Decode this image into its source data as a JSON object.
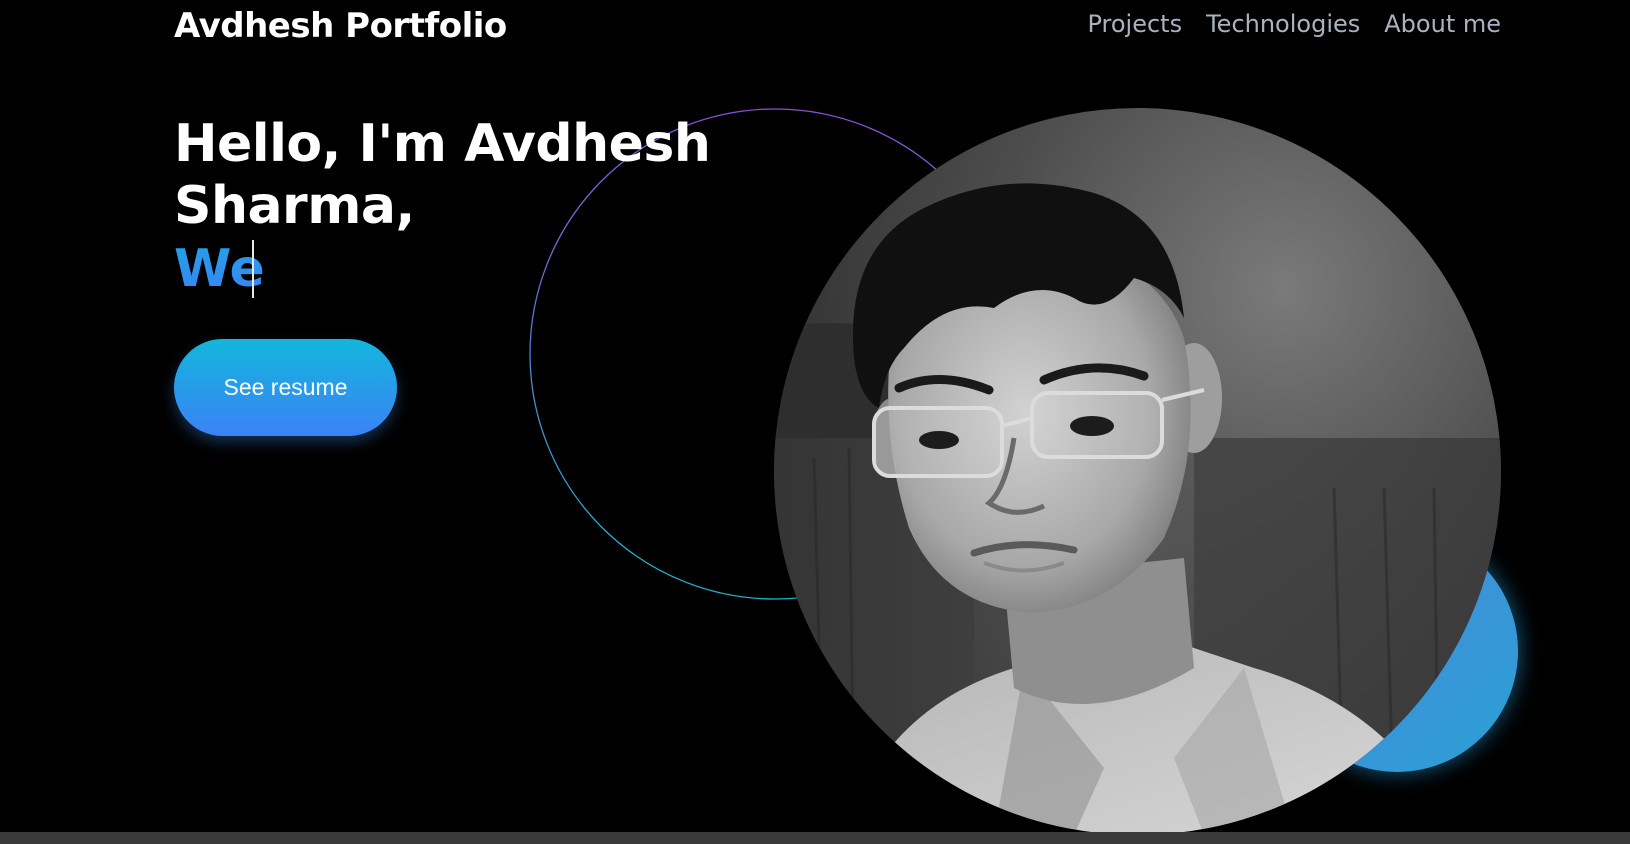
{
  "header": {
    "brand": "Avdhesh Portfolio",
    "nav": [
      {
        "label": "Projects"
      },
      {
        "label": "Technologies"
      },
      {
        "label": "About me"
      }
    ]
  },
  "hero": {
    "title_line1": "Hello, I'm Avdhesh",
    "title_line2": "Sharma,",
    "typed_text": "We",
    "button_label": "See resume"
  },
  "colors": {
    "background": "#000000",
    "accent_gradient_start": "#13b6dc",
    "accent_gradient_end": "#3b82f6",
    "nav_text": "#a9b2bf"
  }
}
